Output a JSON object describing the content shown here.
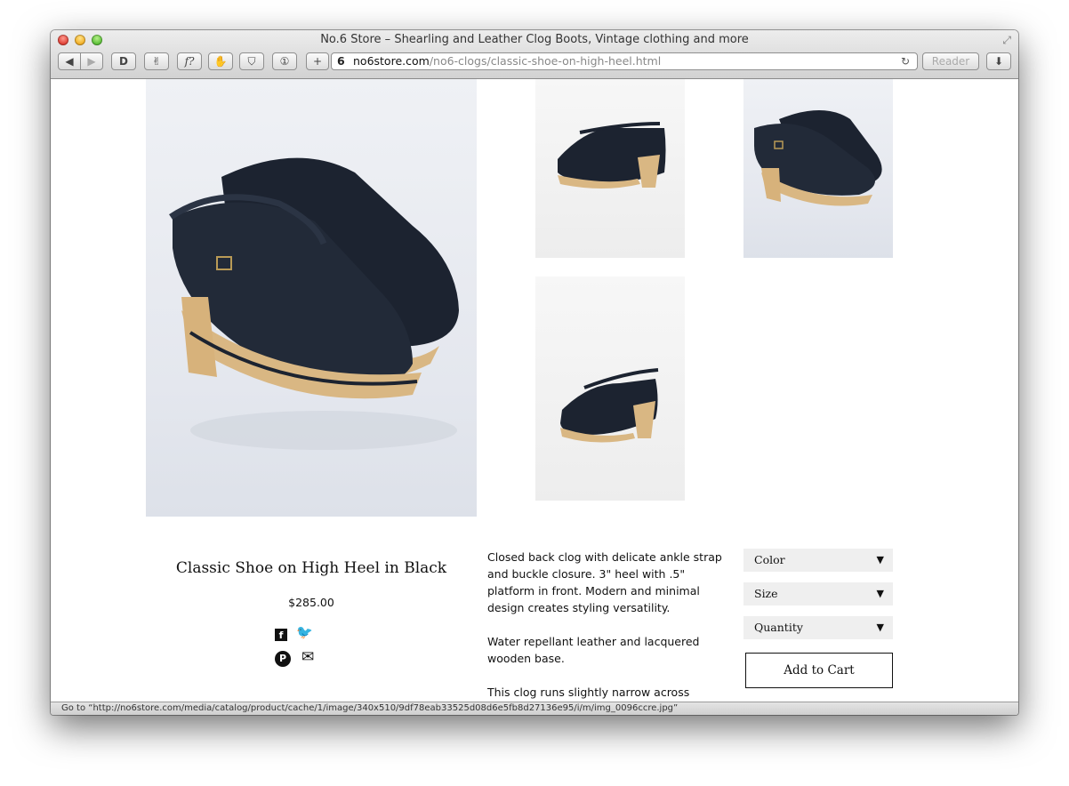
{
  "window": {
    "title": "No.6 Store – Shearling and Leather Clog Boots, Vintage clothing and more"
  },
  "toolbar": {
    "back": "◀",
    "forward": "▶",
    "ext1": "D",
    "ext2": "✌",
    "ext3": "f?",
    "ext4": "✋",
    "ext5": "⛉",
    "ext6": "①",
    "add": "+",
    "reader_label": "Reader",
    "download": "⬇"
  },
  "address": {
    "favicon": "6",
    "domain": "no6store.com",
    "path": "/no6-clogs/classic-shoe-on-high-heel.html",
    "reload": "↻"
  },
  "product": {
    "title": "Classic Shoe on High Heel in Black",
    "price": "$285.00",
    "description": [
      "Closed back clog with delicate ankle strap and buckle closure. 3\" heel with .5\" platform in front. Modern and minimal design creates styling versatility.",
      "Water repellant leather and lacquered wooden base.",
      "This clog runs slightly narrow across"
    ]
  },
  "options": {
    "color_label": "Color",
    "size_label": "Size",
    "quantity_label": "Quantity",
    "arrow": "▼",
    "add_to_cart": "Add to Cart"
  },
  "social": {
    "facebook": "f",
    "twitter": "🐦",
    "pinterest": "P",
    "email": "✉"
  },
  "status_bar": {
    "text": "Go to “http://no6store.com/media/catalog/product/cache/1/image/340x510/9df78eab33525d08d6e5fb8d27136e95/i/m/img_0096ccre.jpg”"
  },
  "colors": {
    "clog_leather": "#1c2330",
    "clog_wood": "#d9b783",
    "select_bg": "#efefef"
  }
}
